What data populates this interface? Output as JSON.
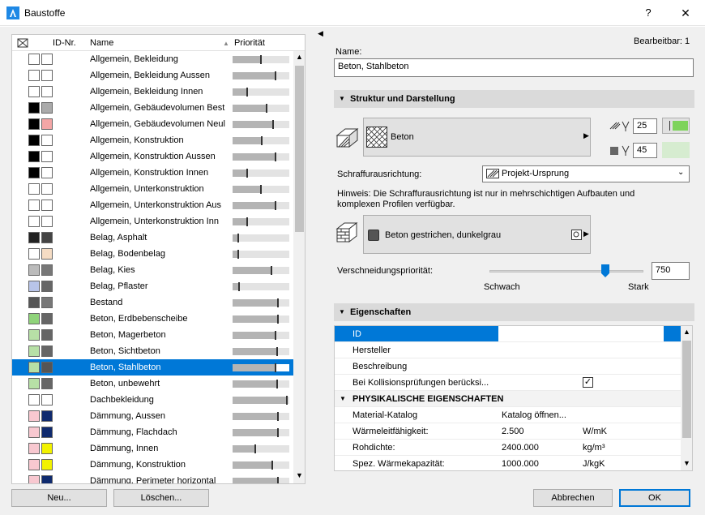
{
  "window": {
    "title": "Baustoffe",
    "help": "?",
    "close": "✕"
  },
  "list": {
    "headers": {
      "id": "ID-Nr.",
      "name": "Name",
      "prio": "Priorität"
    },
    "rows": [
      {
        "name": "Allgemein, Bekleidung",
        "c1": "#ffffff",
        "c2": "#ffffff",
        "p": 0.5
      },
      {
        "name": "Allgemein, Bekleidung Aussen",
        "c1": "#ffffff",
        "c2": "#ffffff",
        "p": 0.75
      },
      {
        "name": "Allgemein, Bekleidung Innen",
        "c1": "#ffffff",
        "c2": "#ffffff",
        "p": 0.25
      },
      {
        "name": "Allgemein, Gebäudevolumen Best",
        "c1": "#000000",
        "c2": "#aaaaaa",
        "p": 0.6
      },
      {
        "name": "Allgemein, Gebäudevolumen Neul",
        "c1": "#000000",
        "c2": "#f4a6a6",
        "p": 0.72
      },
      {
        "name": "Allgemein, Konstruktion",
        "c1": "#000000",
        "c2": "#ffffff",
        "p": 0.52
      },
      {
        "name": "Allgemein, Konstruktion Aussen",
        "c1": "#000000",
        "c2": "#ffffff",
        "p": 0.75
      },
      {
        "name": "Allgemein, Konstruktion Innen",
        "c1": "#000000",
        "c2": "#ffffff",
        "p": 0.25
      },
      {
        "name": "Allgemein, Unterkonstruktion",
        "c1": "#ffffff",
        "c2": "#ffffff",
        "p": 0.5
      },
      {
        "name": "Allgemein, Unterkonstruktion Aus",
        "c1": "#ffffff",
        "c2": "#ffffff",
        "p": 0.75
      },
      {
        "name": "Allgemein, Unterkonstruktion Inn",
        "c1": "#ffffff",
        "c2": "#ffffff",
        "p": 0.25
      },
      {
        "name": "Belag, Asphalt",
        "c1": "#222222",
        "c2": "#444444",
        "p": 0.1
      },
      {
        "name": "Belag, Bodenbelag",
        "c1": "#ffffff",
        "c2": "#f5dcc4",
        "p": 0.1
      },
      {
        "name": "Belag, Kies",
        "c1": "#bbbbbb",
        "c2": "#777777",
        "p": 0.68
      },
      {
        "name": "Belag, Pflaster",
        "c1": "#b8c4e8",
        "c2": "#666666",
        "p": 0.12
      },
      {
        "name": "Bestand",
        "c1": "#555555",
        "c2": "#777777",
        "p": 0.8
      },
      {
        "name": "Beton, Erdbebenscheibe",
        "c1": "#8fd37a",
        "c2": "#666666",
        "p": 0.8
      },
      {
        "name": "Beton, Magerbeton",
        "c1": "#b7e0a6",
        "c2": "#666666",
        "p": 0.75
      },
      {
        "name": "Beton, Sichtbeton",
        "c1": "#b7e0a6",
        "c2": "#666666",
        "p": 0.78
      },
      {
        "name": "Beton, Stahlbeton",
        "c1": "#b7e0a6",
        "c2": "#555555",
        "p": 0.75,
        "selected": true
      },
      {
        "name": "Beton, unbewehrt",
        "c1": "#b7e0a6",
        "c2": "#666666",
        "p": 0.78
      },
      {
        "name": "Dachbekleidung",
        "c1": "#ffffff",
        "c2": "#ffffff",
        "p": 0.95
      },
      {
        "name": "Dämmung, Aussen",
        "c1": "#f8c8d0",
        "c2": "#0f2a6e",
        "p": 0.8
      },
      {
        "name": "Dämmung, Flachdach",
        "c1": "#f8c8d0",
        "c2": "#0f2a6e",
        "p": 0.8
      },
      {
        "name": "Dämmung, Innen",
        "c1": "#f8c8d0",
        "c2": "#f2f200",
        "p": 0.4
      },
      {
        "name": "Dämmung, Konstruktion",
        "c1": "#f8c8d0",
        "c2": "#f2f200",
        "p": 0.7
      },
      {
        "name": "Dämmung, Perimeter horizontal",
        "c1": "#f8c8d0",
        "c2": "#0f2a6e",
        "p": 0.8
      }
    ]
  },
  "buttons": {
    "new": "Neu...",
    "delete": "Löschen...",
    "cancel": "Abbrechen",
    "ok": "OK"
  },
  "right": {
    "editable": "Bearbeitbar: 1",
    "name_label": "Name:",
    "name_value": "Beton, Stahlbeton",
    "section_structure": "Struktur und Darstellung",
    "fill_name": "Beton",
    "pen1_value": "25",
    "pen2_value": "45",
    "fill_orientation_label": "Schraffurausrichtung:",
    "fill_orientation_value": "Projekt-Ursprung",
    "hint": "Hinweis: Die Schraffurausrichtung ist nur in mehrschichtigen Aufbauten und komplexen Profilen verfügbar.",
    "surface_name": "Beton gestrichen, dunkelgrau",
    "intersection_label": "Verschneidungspriorität:",
    "intersection_value": "750",
    "intersection_level": 0.75,
    "weak": "Schwach",
    "strong": "Stark",
    "section_properties": "Eigenschaften",
    "properties": [
      {
        "key": "ID",
        "value": "",
        "unit": "",
        "selected": true
      },
      {
        "key": "Hersteller",
        "value": "",
        "unit": ""
      },
      {
        "key": "Beschreibung",
        "value": "",
        "unit": ""
      },
      {
        "key": "Bei Kollisionsprüfungen berücksi...",
        "value": "",
        "unit": "",
        "check": true
      }
    ],
    "physical_header": "PHYSIKALISCHE EIGENSCHAFTEN",
    "physical": [
      {
        "key": "Material-Katalog",
        "value": "Katalog öffnen...",
        "unit": ""
      },
      {
        "key": "Wärmeleitfähigkeit:",
        "value": "2.500",
        "unit": "W/mK"
      },
      {
        "key": "Rohdichte:",
        "value": "2400.000",
        "unit": "kg/m³"
      },
      {
        "key": "Spez. Wärmekapazität:",
        "value": "1000.000",
        "unit": "J/kgK"
      }
    ]
  }
}
